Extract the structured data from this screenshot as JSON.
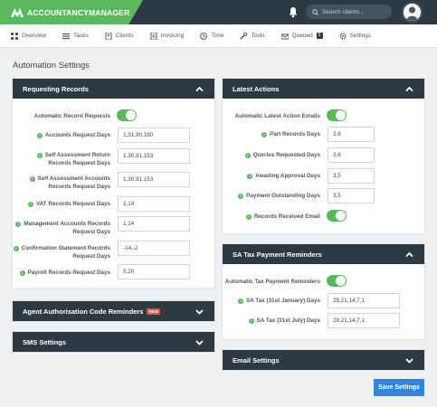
{
  "brand": {
    "name": "ACCOUNTANCYMANAGER"
  },
  "header": {
    "search_placeholder": "Search clients..."
  },
  "nav": {
    "items": [
      {
        "label": "Overview",
        "icon": "overview-icon"
      },
      {
        "label": "Tasks",
        "icon": "tasks-icon"
      },
      {
        "label": "Clients",
        "icon": "clients-icon"
      },
      {
        "label": "Invoicing",
        "icon": "invoicing-icon"
      },
      {
        "label": "Time",
        "icon": "clock-icon"
      },
      {
        "label": "Tools",
        "icon": "wrench-icon"
      },
      {
        "label": "Queued",
        "icon": "queued-icon",
        "badge": "5"
      },
      {
        "label": "Settings",
        "icon": "gear-icon"
      }
    ]
  },
  "page": {
    "title": "Automation Settings"
  },
  "requesting_records": {
    "title": "Requesting Records",
    "auto_label": "Automatic Record Requests",
    "auto_enabled": true,
    "fields": [
      {
        "label": "Accounts Request Days",
        "value": "1,31,90,180"
      },
      {
        "label": "Self Assessment Return Records Request Days",
        "value": "1,30,91,153"
      },
      {
        "label": "Self Assessment Accounts Records Request Days",
        "value": "1,30,91,153"
      },
      {
        "label": "VAT Records Request Days",
        "value": "1,14"
      },
      {
        "label": "Management Accounts Records Request Days",
        "value": "1,14"
      },
      {
        "label": "Confirmation Statement Records Request Days",
        "value": "-14,-2"
      },
      {
        "label": "Payroll Records Request Days",
        "value": "5,20"
      }
    ]
  },
  "latest_actions": {
    "title": "Latest Actions",
    "auto_label": "Automatic Latest Action Emails",
    "auto_enabled": true,
    "fields": [
      {
        "label": "Part Records Days",
        "value": "3,6"
      },
      {
        "label": "Queries Requested Days",
        "value": "3,6"
      },
      {
        "label": "Awaiting Approval Days",
        "value": "3,5"
      },
      {
        "label": "Payment Outstanding Days",
        "value": "3,5"
      }
    ],
    "received_label": "Records Received Email",
    "received_enabled": true
  },
  "sa_tax": {
    "title": "SA Tax Payment Reminders",
    "auto_label": "Automatic Tax Payment Reminders",
    "auto_enabled": true,
    "fields": [
      {
        "label": "SA Tax (31st January) Days",
        "value": "28,21,14,7,1"
      },
      {
        "label": "SA Tax (31st July) Days",
        "value": "28,21,14,7,1"
      }
    ]
  },
  "agent_auth": {
    "title": "Agent Authorisation Code Reminders",
    "badge": "NEW"
  },
  "sms": {
    "title": "SMS Settings"
  },
  "email": {
    "title": "Email Settings"
  },
  "actions": {
    "save_label": "Save Settings"
  },
  "colors": {
    "accent_green": "#5cb85c",
    "header_dark": "#2d3a44",
    "save_blue": "#2e86de",
    "new_badge_red": "#d9534f"
  }
}
